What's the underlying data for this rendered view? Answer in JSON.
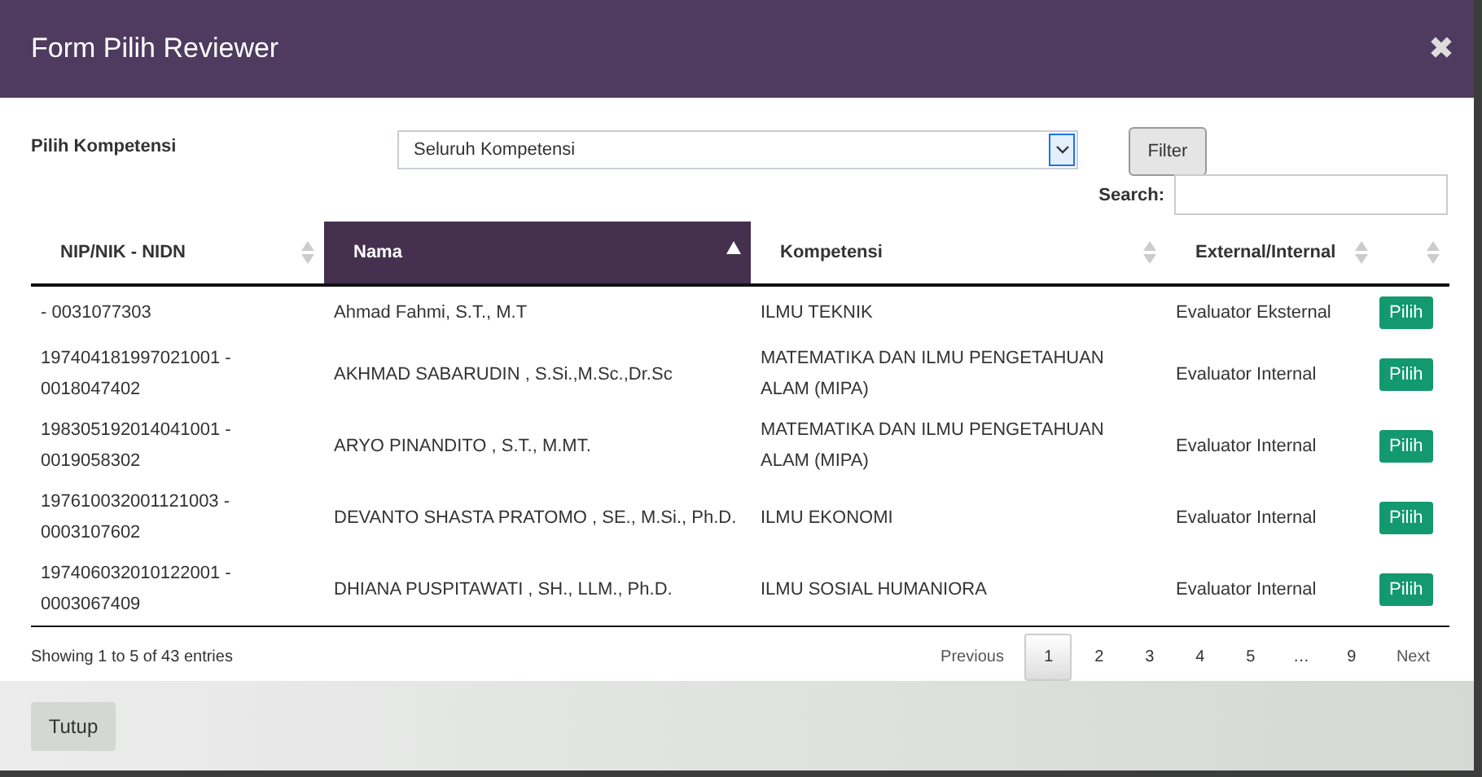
{
  "modal": {
    "title": "Form Pilih Reviewer",
    "close": "✖"
  },
  "filter": {
    "label": "Pilih Kompetensi",
    "select_value": "Seluruh Kompetensi",
    "button": "Filter"
  },
  "search": {
    "label": "Search:"
  },
  "table": {
    "columns": [
      {
        "label": "NIP/NIK - NIDN",
        "sorted": false
      },
      {
        "label": "Nama",
        "sorted": true
      },
      {
        "label": "Kompetensi",
        "sorted": false
      },
      {
        "label": "External/Internal",
        "sorted": false
      },
      {
        "sorted": false
      }
    ],
    "rows": [
      {
        "nip": "- 0031077303",
        "nama": "Ahmad Fahmi, S.T., M.T",
        "kompetensi": "ILMU TEKNIK",
        "type": "Evaluator Eksternal",
        "action": "Pilih"
      },
      {
        "nip": "197404181997021001 - 0018047402",
        "nama": "AKHMAD SABARUDIN , S.Si.,M.Sc.,Dr.Sc",
        "kompetensi": "MATEMATIKA DAN ILMU PENGETAHUAN ALAM (MIPA)",
        "type": "Evaluator Internal",
        "action": "Pilih"
      },
      {
        "nip": "198305192014041001 - 0019058302",
        "nama": "ARYO PINANDITO , S.T., M.MT.",
        "kompetensi": "MATEMATIKA DAN ILMU PENGETAHUAN ALAM (MIPA)",
        "type": "Evaluator Internal",
        "action": "Pilih"
      },
      {
        "nip": "197610032001121003 - 0003107602",
        "nama": "DEVANTO SHASTA PRATOMO , SE., M.Si., Ph.D.",
        "kompetensi": "ILMU EKONOMI",
        "type": "Evaluator Internal",
        "action": "Pilih"
      },
      {
        "nip": "197406032010122001 - 0003067409",
        "nama": "DHIANA PUSPITAWATI , SH., LLM., Ph.D.",
        "kompetensi": "ILMU SOSIAL HUMANIORA",
        "type": "Evaluator Internal",
        "action": "Pilih"
      }
    ]
  },
  "info": "Showing 1 to 5 of 43 entries",
  "pagination": {
    "previous": "Previous",
    "next": "Next",
    "pages": [
      {
        "label": "1",
        "selected": true
      },
      {
        "label": "2",
        "selected": false
      },
      {
        "label": "3",
        "selected": false
      },
      {
        "label": "4",
        "selected": false
      },
      {
        "label": "5",
        "selected": false
      },
      {
        "label": "…",
        "selected": false
      },
      {
        "label": "9",
        "selected": false
      }
    ]
  },
  "footer": {
    "button": "Tutup"
  }
}
